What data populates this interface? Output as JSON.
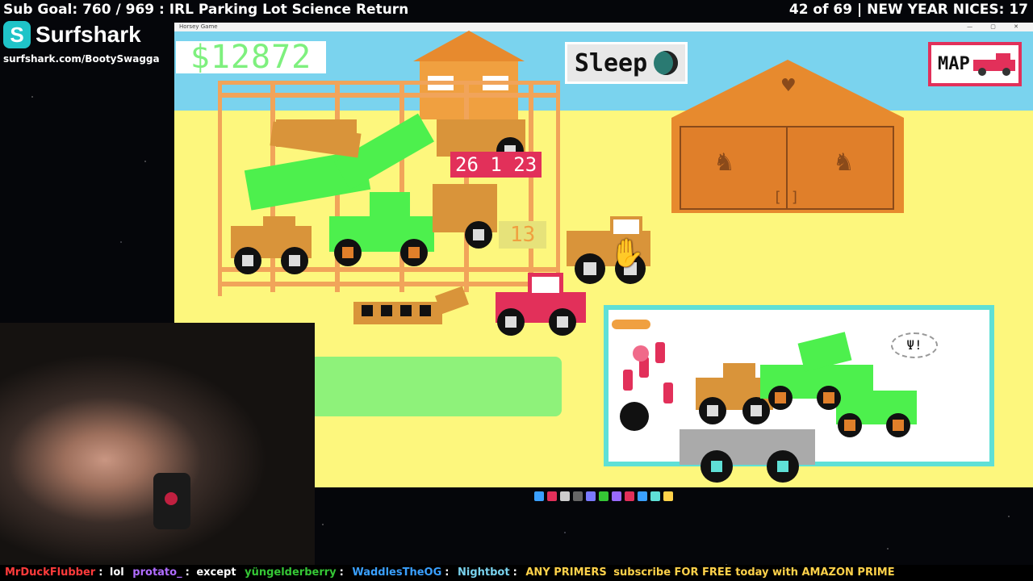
{
  "stream": {
    "sub_goal": "Sub Goal: 760 / 969 : IRL Parking Lot Science Return",
    "counter": "42 of 69 | NEW YEAR NICES: 17",
    "sponsor_name": "Surfshark",
    "sponsor_mark": "S",
    "sponsor_url": "surfshark.com/BootySwagga"
  },
  "game": {
    "window_title": "Horsey Game",
    "window_controls": "— ▢ ✕",
    "money": "$12872",
    "sleep_label": "Sleep",
    "map_label": "MAP",
    "price_tag": "26 1 23",
    "sold_tag": "13",
    "bubble_text": "Ψ!",
    "barn_slot": "[ ]",
    "colors": {
      "green": "#4df04d",
      "orange": "#e78a2e",
      "red": "#e2305a",
      "teal": "#5fe0d6",
      "yellow": "#fdf77d"
    }
  },
  "chat": [
    {
      "user": "MrDuckFlubber",
      "color": "#ff3b3b",
      "message": "lol"
    },
    {
      "user": "protato_",
      "color": "#b06cff",
      "message": "except"
    },
    {
      "user": "yüngelderberry",
      "color": "#35c735",
      "message": ""
    },
    {
      "user": "WaddlesTheOG",
      "color": "#3aa0ff",
      "message": ""
    },
    {
      "user": "Nightbot",
      "color": "#7ad3ee",
      "message": ""
    },
    {
      "user": "ANY PRIMERS",
      "color": "#ffd24a",
      "message": "subscribe FOR FREE today with AMAZON PRIME"
    }
  ]
}
